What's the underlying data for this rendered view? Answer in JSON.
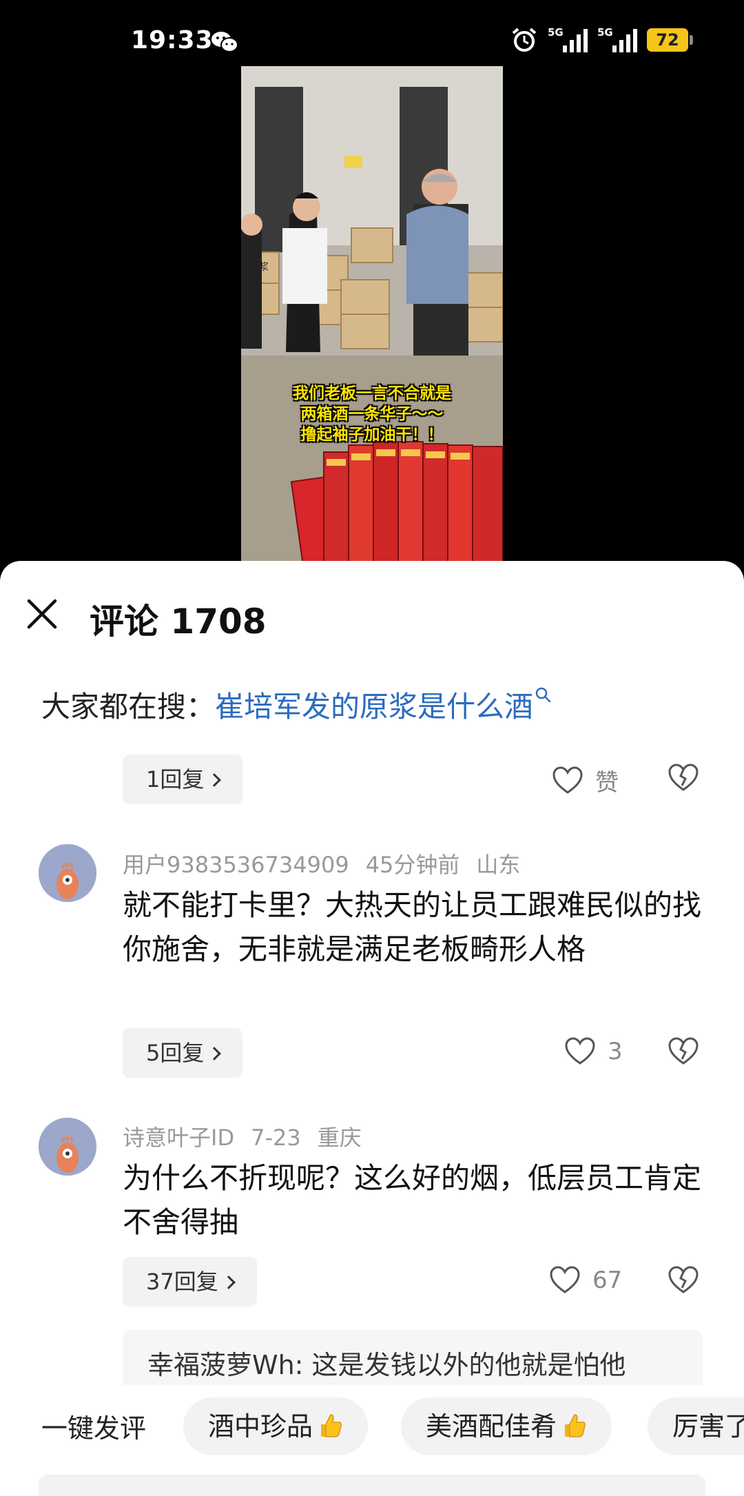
{
  "status_bar": {
    "time": "19:33",
    "network_1": "5G",
    "network_2": "5G",
    "battery": "72"
  },
  "video": {
    "caption_lines": [
      "我们老板一言不合就是",
      "两箱酒一条华子～～",
      "撸起袖子加油干！！"
    ],
    "box_label": "原浆"
  },
  "comments_panel": {
    "title": "评论 1708",
    "search_prefix": "大家都在搜：",
    "search_query": "崔培军发的原浆是什么酒",
    "top_reply": "1回复",
    "top_like_label": "赞",
    "comments": [
      {
        "user": "用户9383536734909",
        "time": "45分钟前",
        "location": "山东",
        "text": "就不能打卡里？大热天的让员工跟难民似的找你施舍，无非就是满足老板畸形人格",
        "reply_label": "5回复",
        "likes": "3"
      },
      {
        "user": "诗意叶子ID",
        "time": "7-23",
        "location": "重庆",
        "text": "为什么不折现呢？这么好的烟，低层员工肯定不舍得抽",
        "reply_label": "37回复",
        "likes": "67"
      }
    ],
    "sub_reply_preview": "幸福菠萝Wh: 这是发钱以外的他就是怕他"
  },
  "quick_comment": {
    "label": "一键发评",
    "chips": [
      "酒中珍品",
      "美酒配佳肴",
      "厉害了"
    ]
  },
  "icons": {
    "close": "close-icon",
    "heart": "heart-icon",
    "broken_heart": "broken-heart-icon",
    "search": "search-icon",
    "thumb": "thumbs-up-emoji",
    "alarm": "alarm-icon",
    "wechat": "wechat-icon"
  },
  "colors": {
    "link": "#2b6bbf",
    "battery": "#f5c518",
    "avatar": "#9ba8cc"
  }
}
